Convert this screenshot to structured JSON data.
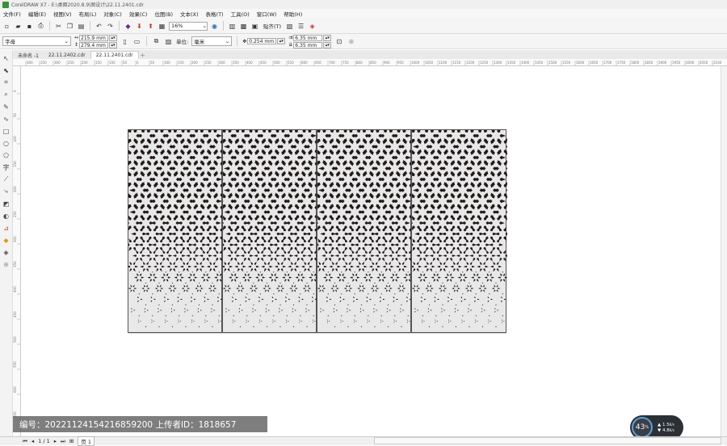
{
  "window": {
    "title": "CorelDRAW X7 - E:\\桌面2020.8.9\\图设计\\22.11.2401.cdr"
  },
  "menu": [
    "文件(F)",
    "编辑(E)",
    "视图(V)",
    "布局(L)",
    "对象(C)",
    "效果(C)",
    "位图(B)",
    "文本(X)",
    "表格(T)",
    "工具(O)",
    "窗口(W)",
    "帮助(H)"
  ],
  "toolbar": {
    "zoom": "16%",
    "snap_label": "贴齐(T)"
  },
  "property_bar": {
    "preset": "字母",
    "width": "215.9 mm",
    "height": "279.4 mm",
    "units_label": "单位:",
    "units_value": "毫米",
    "nudge": "0.254 mm",
    "dup_x": "6.35 mm",
    "dup_y": "6.35 mm"
  },
  "tabs": [
    "未命名 -1",
    "22.11.2402.cdr",
    "22.11.2401.cdr"
  ],
  "active_tab": 2,
  "hruler_labels": [
    "400",
    "350",
    "300",
    "250",
    "200",
    "150",
    "100",
    "50",
    "0",
    "50",
    "100",
    "150",
    "200",
    "250",
    "300",
    "350",
    "400",
    "450",
    "500",
    "550",
    "600",
    "650",
    "700",
    "750",
    "800",
    "850",
    "900",
    "950",
    "1000",
    "1050",
    "1100",
    "1150",
    "1200",
    "1250",
    "1300",
    "1350",
    "1400",
    "1450",
    "1500",
    "1550",
    "1600",
    "1650",
    "1700",
    "1750",
    "1800",
    "1850",
    "1900",
    "1950",
    "2000",
    "2050",
    "2100"
  ],
  "vruler_labels": [
    "0",
    "50",
    "100",
    "150",
    "200",
    "250",
    "300",
    "350",
    "400",
    "450",
    "500",
    "550",
    "600",
    "650",
    "700",
    "750",
    "800",
    "850"
  ],
  "status": {
    "page_counter": "1 / 1",
    "page_tab": "页 1"
  },
  "watermark": "编号：20221124154216859200 上传者ID：1818657",
  "network_widget": {
    "percent": "43",
    "up": "1.5",
    "down": "4.8"
  },
  "colors": {
    "panel_bg": "#e8e8e8",
    "pattern": "#231a1a",
    "accent": "#5aa0d8"
  }
}
